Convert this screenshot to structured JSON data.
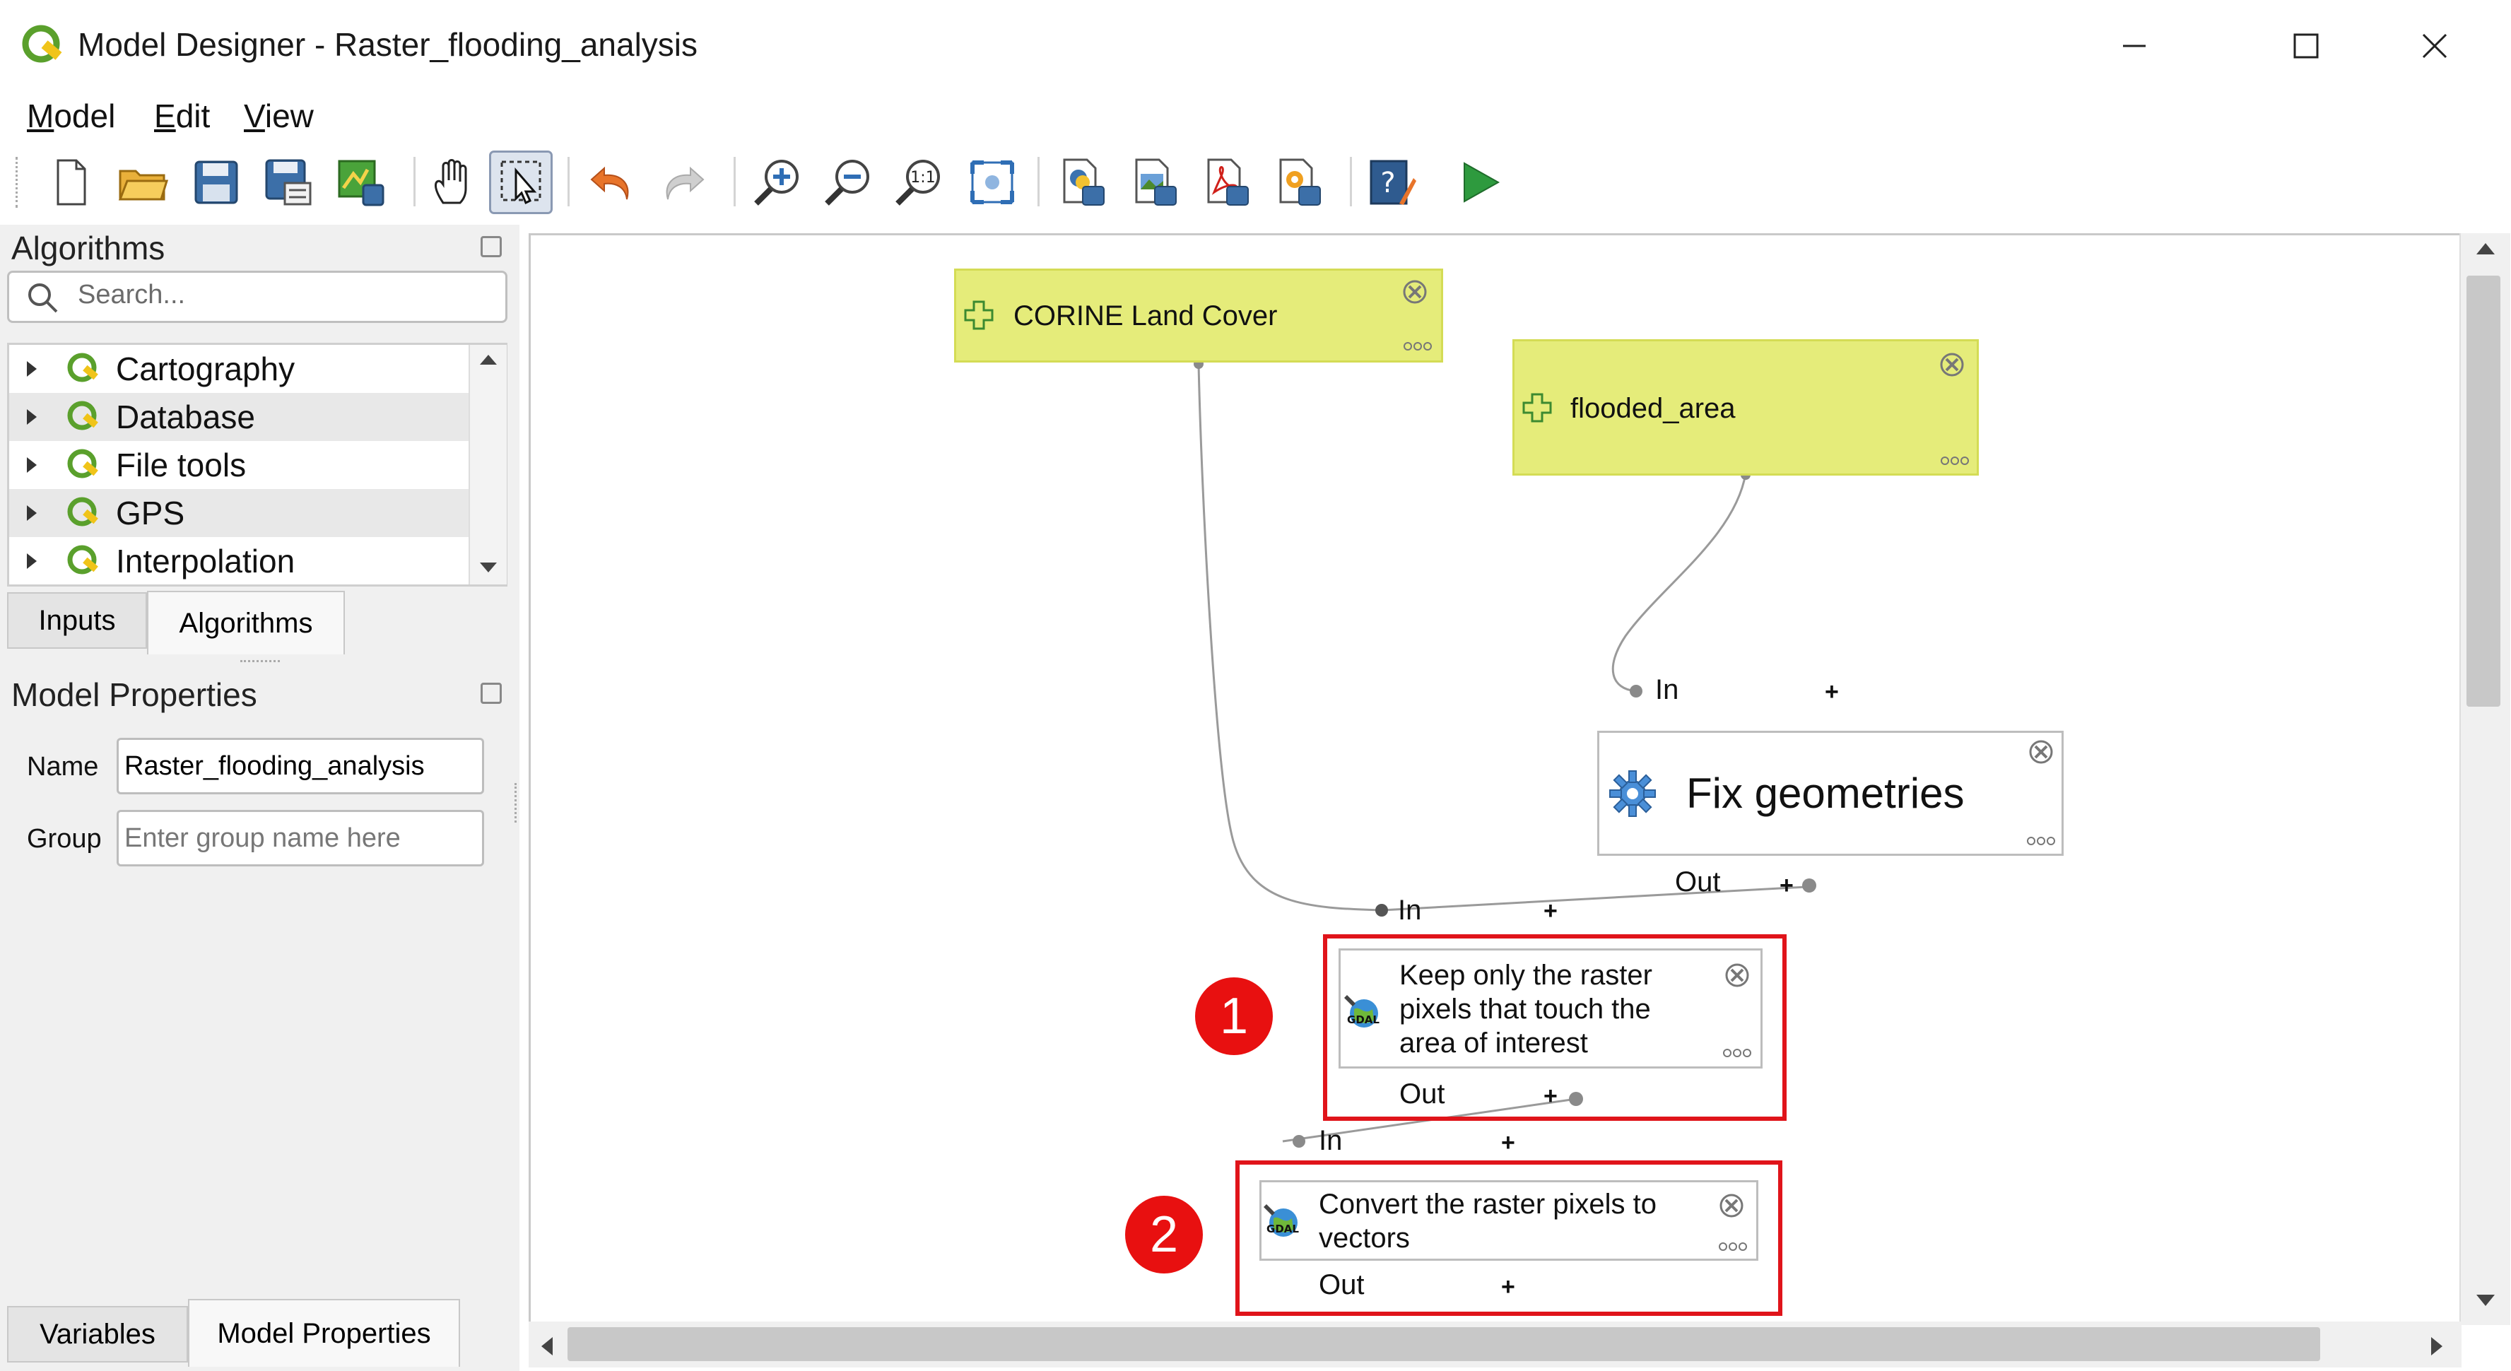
{
  "window": {
    "title": "Model Designer - Raster_flooding_analysis",
    "controls": [
      "minimize",
      "maximize",
      "close"
    ]
  },
  "menu": [
    {
      "label": "Model",
      "mnemonic": "M"
    },
    {
      "label": "Edit",
      "mnemonic": "E"
    },
    {
      "label": "View",
      "mnemonic": "V"
    }
  ],
  "toolbar": {
    "icons": [
      "new-model-icon",
      "open-model-icon",
      "save-model-icon",
      "save-as-icon",
      "save-to-project-icon",
      "pan-icon",
      "select-icon",
      "undo-icon",
      "redo-icon",
      "zoom-in-icon",
      "zoom-out-icon",
      "zoom-actual-icon",
      "zoom-full-icon",
      "export-python-icon",
      "export-image-icon",
      "export-pdf-icon",
      "export-svg-icon",
      "edit-help-icon",
      "run-model-icon"
    ],
    "active": "select-icon"
  },
  "algorithms_panel": {
    "title": "Algorithms",
    "search_placeholder": "Search...",
    "tree": [
      {
        "label": "Cartography"
      },
      {
        "label": "Database"
      },
      {
        "label": "File tools"
      },
      {
        "label": "GPS"
      },
      {
        "label": "Interpolation"
      }
    ],
    "tabs": [
      {
        "label": "Inputs",
        "active": false
      },
      {
        "label": "Algorithms",
        "active": true
      }
    ]
  },
  "model_properties": {
    "title": "Model Properties",
    "name_label": "Name",
    "name_value": "Raster_flooding_analysis",
    "group_label": "Group",
    "group_placeholder": "Enter group name here",
    "tabs": [
      {
        "label": "Variables",
        "active": false
      },
      {
        "label": "Model Properties",
        "active": true
      }
    ]
  },
  "canvas": {
    "inputs": [
      {
        "label": "CORINE Land Cover"
      },
      {
        "label": "flooded_area"
      }
    ],
    "algorithms": [
      {
        "label": "Fix geometries",
        "in": "In",
        "out": "Out"
      },
      {
        "label": "Keep only the raster pixels that touch the area of interest",
        "in": "In",
        "out": "Out",
        "badge": "1"
      },
      {
        "label": "Convert the raster pixels to vectors",
        "in": "In",
        "out": "Out",
        "badge": "2"
      }
    ],
    "colors": {
      "input_fill": "#e5ec7a",
      "highlight": "#e0141a",
      "badge": "#e81010"
    }
  }
}
